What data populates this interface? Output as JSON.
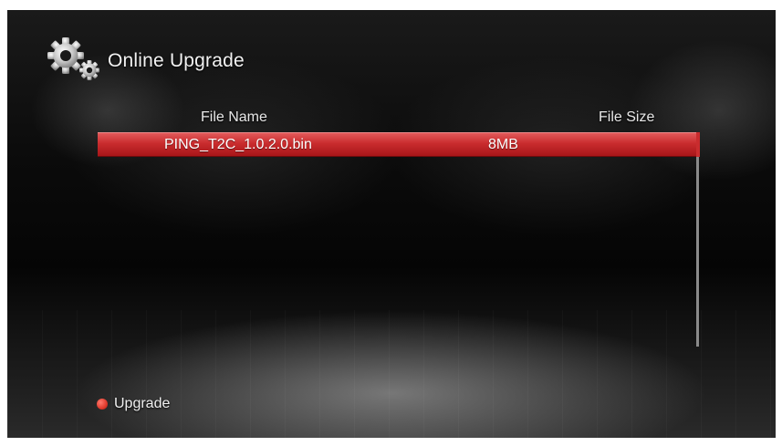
{
  "header": {
    "title": "Online Upgrade",
    "icon": "gears-icon"
  },
  "table": {
    "columns": [
      "File Name",
      "File Size"
    ],
    "rows": [
      {
        "name": "PING_T2C_1.0.2.0.bin",
        "size": "8MB",
        "selected": true
      }
    ]
  },
  "footer": {
    "hint_color": "#e03a2c",
    "hint_label": "Upgrade"
  },
  "colors": {
    "selection": "#c92c2e",
    "background": "#0b0b0b"
  }
}
